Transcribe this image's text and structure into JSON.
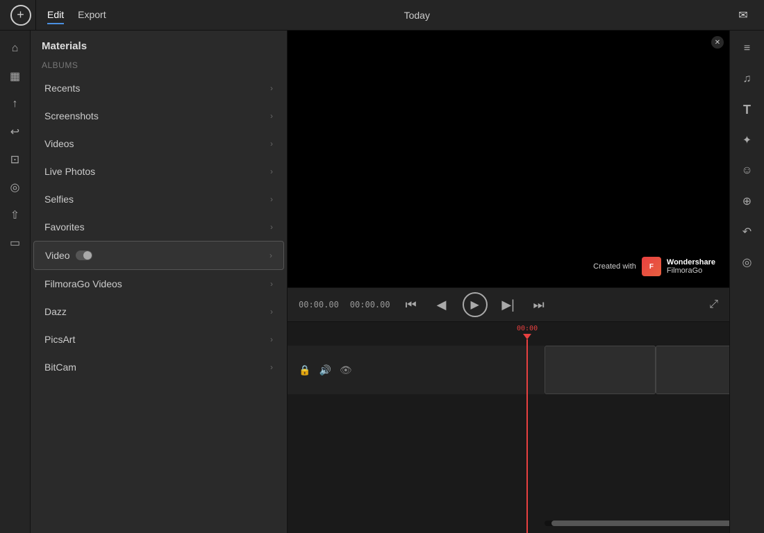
{
  "topBar": {
    "addBtnLabel": "+",
    "tabs": [
      {
        "id": "edit",
        "label": "Edit",
        "active": true
      },
      {
        "id": "export",
        "label": "Export",
        "active": false
      }
    ],
    "centerTitle": "Today",
    "messageIconLabel": "✉"
  },
  "leftIconSidebar": {
    "icons": [
      {
        "id": "home",
        "symbol": "⌂"
      },
      {
        "id": "layers",
        "symbol": "▦"
      },
      {
        "id": "export-arrow",
        "symbol": "↑"
      },
      {
        "id": "undo",
        "symbol": "↩"
      },
      {
        "id": "crop",
        "symbol": "⊡"
      },
      {
        "id": "headphones",
        "symbol": "◎"
      },
      {
        "id": "share",
        "symbol": "⇧"
      },
      {
        "id": "device",
        "symbol": "▭"
      }
    ]
  },
  "leftPanel": {
    "title": "Materials",
    "albumsLabel": "Albums",
    "menuItems": [
      {
        "id": "recents",
        "label": "Recents",
        "hasChevron": true,
        "hasToggle": false,
        "selected": false
      },
      {
        "id": "screenshots",
        "label": "Screenshots",
        "hasChevron": true,
        "hasToggle": false,
        "selected": false
      },
      {
        "id": "videos",
        "label": "Videos",
        "hasChevron": true,
        "hasToggle": false,
        "selected": false
      },
      {
        "id": "live-photos",
        "label": "Live Photos",
        "hasChevron": true,
        "hasToggle": false,
        "selected": false
      },
      {
        "id": "selfies",
        "label": "Selfies",
        "hasChevron": true,
        "hasToggle": false,
        "selected": false
      },
      {
        "id": "favorites",
        "label": "Favorites",
        "hasChevron": true,
        "hasToggle": false,
        "selected": false
      },
      {
        "id": "video",
        "label": "Video",
        "hasChevron": true,
        "hasToggle": true,
        "selected": true
      },
      {
        "id": "filmorago-videos",
        "label": "FilmoraGo Videos",
        "hasChevron": true,
        "hasToggle": false,
        "selected": false
      },
      {
        "id": "dazz",
        "label": "Dazz",
        "hasChevron": true,
        "hasToggle": false,
        "selected": false
      },
      {
        "id": "picsart",
        "label": "PicsArt",
        "hasChevron": true,
        "hasToggle": false,
        "selected": false
      },
      {
        "id": "bitcam",
        "label": "BitCam",
        "hasChevron": true,
        "hasToggle": false,
        "selected": false
      }
    ]
  },
  "videoPreview": {
    "watermark": {
      "createdWith": "Created with",
      "brand1": "Wondershare",
      "brand2": "FilmoraGo"
    }
  },
  "controls": {
    "time1": "00:00.00",
    "time2": "00:00.00",
    "playhead": "00:00"
  },
  "rightSidebar": {
    "icons": [
      {
        "id": "hamburger",
        "symbol": "≡"
      },
      {
        "id": "music",
        "symbol": "♫"
      },
      {
        "id": "text",
        "symbol": "T"
      },
      {
        "id": "sticker",
        "symbol": "✦"
      },
      {
        "id": "emoji",
        "symbol": "☺"
      },
      {
        "id": "mask",
        "symbol": "⊕"
      },
      {
        "id": "curve",
        "symbol": "↶"
      },
      {
        "id": "audio-wave",
        "symbol": "◎"
      }
    ]
  }
}
